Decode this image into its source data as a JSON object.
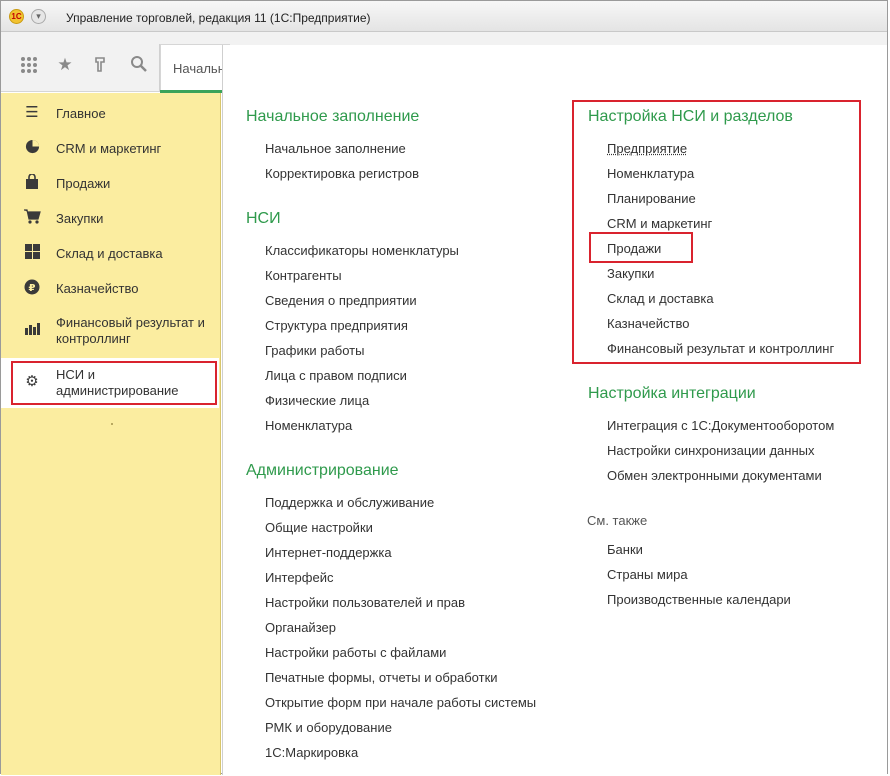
{
  "window": {
    "logo_text": "1С",
    "title": "Управление торговлей, редакция 11  (1С:Предприятие)"
  },
  "toolbar": {
    "icons": [
      "apps-grid-icon",
      "star-icon",
      "history-icon",
      "search-icon"
    ],
    "start_tab_label": "Начальная страница"
  },
  "sidebar": {
    "items": [
      {
        "label": "Главное",
        "icon": "menu-lines-icon"
      },
      {
        "label": "CRM и маркетинг",
        "icon": "pie-chart-icon"
      },
      {
        "label": "Продажи",
        "icon": "shopping-bag-icon"
      },
      {
        "label": "Закупки",
        "icon": "cart-icon"
      },
      {
        "label": "Склад и доставка",
        "icon": "warehouse-grid-icon"
      },
      {
        "label": "Казначейство",
        "icon": "ruble-coin-icon"
      },
      {
        "label": "Финансовый результат и контроллинг",
        "line1": "Финансовый результат и",
        "line2": "контроллинг",
        "icon": "bar-chart-icon"
      },
      {
        "label": "НСИ и администрирование",
        "line1": "НСИ и",
        "line2": "администрирование",
        "icon": "gear-icon"
      }
    ],
    "active_index": 7
  },
  "left_column": {
    "initial_fill": {
      "title": "Начальное заполнение",
      "links": [
        "Начальное заполнение",
        "Корректировка регистров"
      ]
    },
    "nsi": {
      "title": "НСИ",
      "links": [
        "Классификаторы номенклатуры",
        "Контрагенты",
        "Сведения о предприятии",
        "Структура предприятия",
        "Графики работы",
        "Лица с правом подписи",
        "Физические лица",
        "Номенклатура"
      ]
    },
    "admin": {
      "title": "Администрирование",
      "links": [
        "Поддержка и обслуживание",
        "Общие настройки",
        "Интернет-поддержка",
        "Интерфейс",
        "Настройки пользователей и прав",
        "Органайзер",
        "Настройки работы с файлами",
        "Печатные формы, отчеты и обработки",
        "Открытие форм при начале работы системы",
        "РМК и оборудование",
        "1С:Маркировка"
      ]
    }
  },
  "right_column": {
    "nsi_settings": {
      "title": "Настройка НСИ и разделов",
      "links": [
        "Предприятие",
        "Номенклатура",
        "Планирование",
        "CRM и маркетинг",
        "Продажи",
        "Закупки",
        "Склад и доставка",
        "Казначейство",
        "Финансовый результат и контроллинг"
      ]
    },
    "integration": {
      "title": "Настройка интеграции",
      "links": [
        "Интеграция с 1С:Документооборотом",
        "Настройки синхронизации данных",
        "Обмен электронными документами"
      ]
    },
    "see_also": {
      "title": "См. также",
      "links": [
        "Банки",
        "Страны мира",
        "Производственные календари"
      ]
    }
  },
  "colors": {
    "section_title": "#2f9a4c",
    "sidebar_bg": "#fbeda0",
    "highlight_box": "#d9232e"
  }
}
